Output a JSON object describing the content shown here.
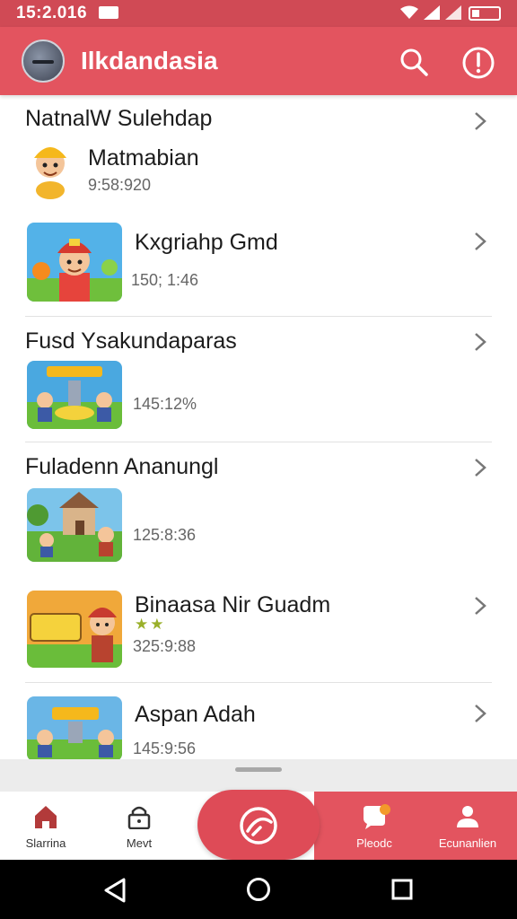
{
  "status_bar": {
    "time": "15:2.016"
  },
  "app_bar": {
    "title": "Ilkdandasia",
    "icons": {
      "logo": "app-logo",
      "search": "search-icon",
      "info": "info-icon"
    }
  },
  "sections": [
    {
      "title": "NatnalW Sulehdap",
      "item": {
        "name": "Matmabian",
        "meta": "9:58:920",
        "thumb": "boy-miner-character"
      }
    },
    {
      "title": "",
      "item": {
        "name": "Kxgriahp Gmd",
        "meta": "150; 1:46",
        "thumb": "hero-character-with-hat"
      }
    },
    {
      "title": "Fusd Ysakundaparas",
      "item": {
        "name": "",
        "meta": "145:12%",
        "thumb": "two-miners-on-gold"
      }
    },
    {
      "title": "Fuladenn Ananungl",
      "item": {
        "name": "",
        "meta": "125:8:36",
        "thumb": "miners-and-house"
      }
    },
    {
      "title": "",
      "item": {
        "name": "Binaasa Nir Guadm",
        "meta": "325:9:88",
        "thumb": "banner-game-character",
        "stars": "★★"
      }
    },
    {
      "title": "",
      "item": {
        "name": "Aspan Adah",
        "meta": "145:9:56",
        "thumb": "two-miners-tower"
      }
    }
  ],
  "bottom_nav": {
    "items": [
      {
        "label": "Slarrina",
        "icon": "home-icon"
      },
      {
        "label": "Mevt",
        "icon": "lock-icon"
      },
      {
        "label": "Pleodc",
        "icon": "chat-icon"
      },
      {
        "label": "Ecunanlien",
        "icon": "person-icon"
      }
    ],
    "center_icon": "center-action-icon"
  },
  "colors": {
    "primary": "#e3545f",
    "status": "#d04a55"
  }
}
